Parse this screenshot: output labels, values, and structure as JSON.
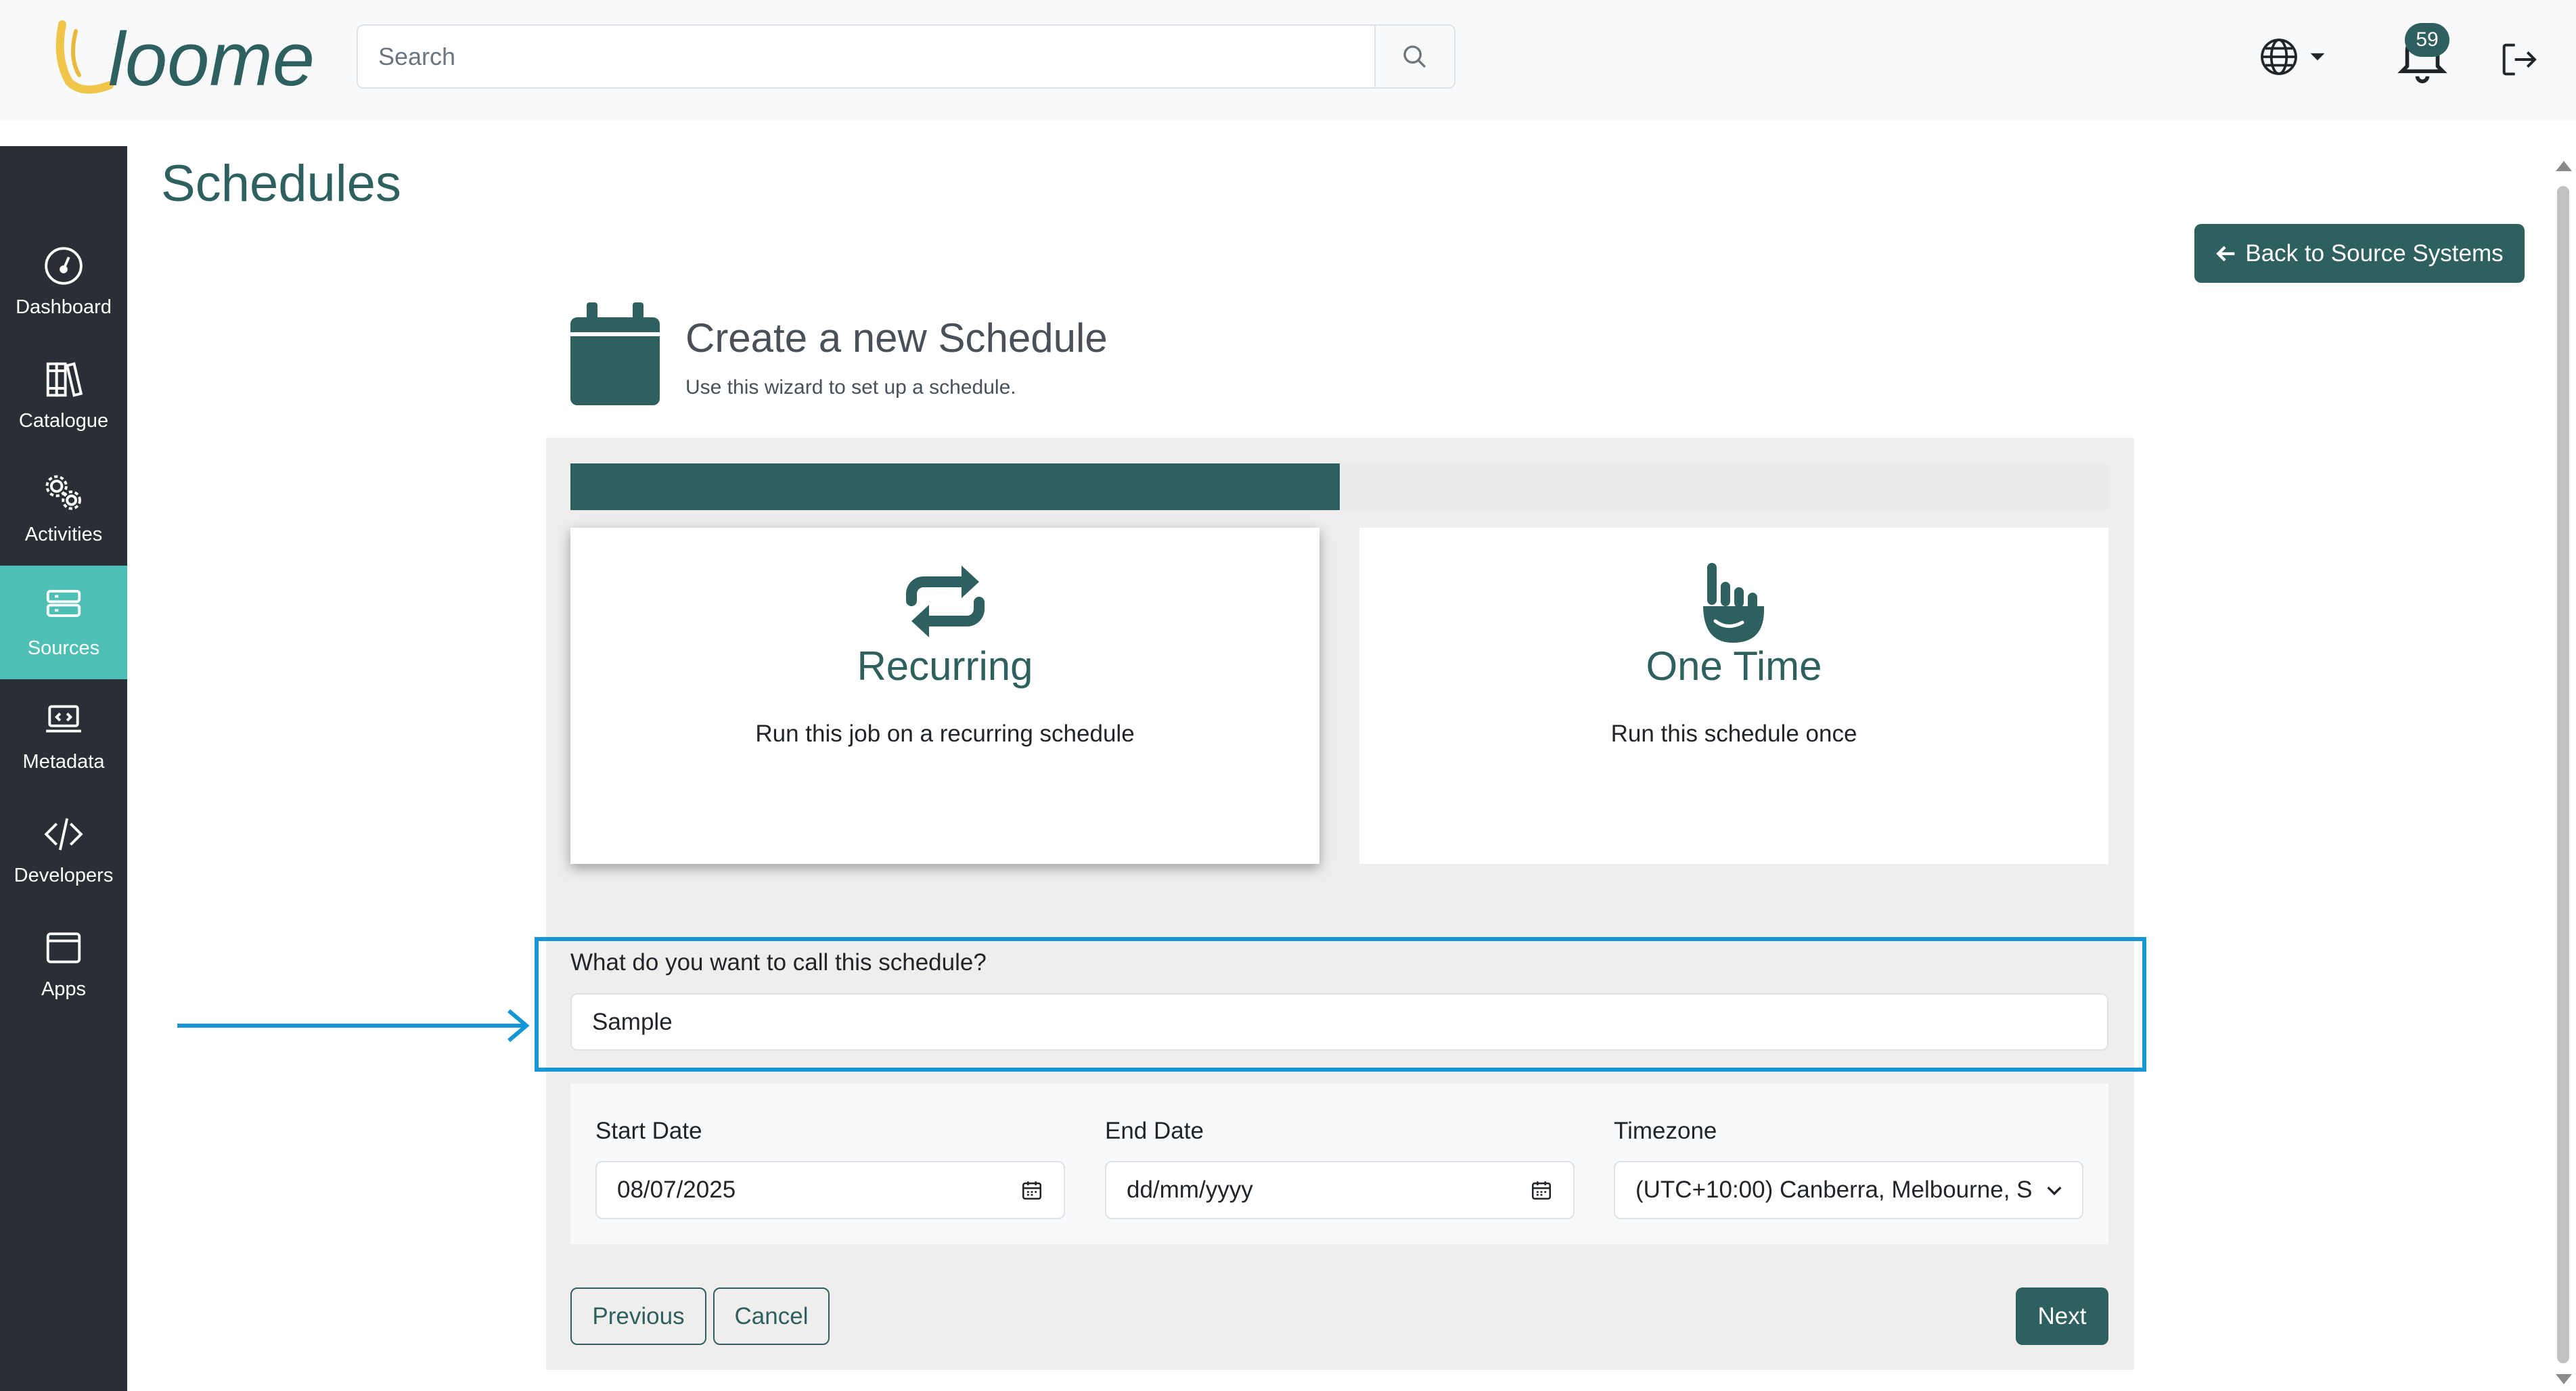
{
  "header": {
    "logo_text": "loome",
    "search": {
      "placeholder": "Search",
      "value": ""
    },
    "notifications_count": "59",
    "icons": [
      "globe-icon",
      "chevron-down-icon",
      "bell-icon",
      "logout-icon",
      "search-icon"
    ]
  },
  "sidebar": {
    "items": [
      {
        "label": "Dashboard",
        "icon": "dashboard-gauge-icon",
        "active": false
      },
      {
        "label": "Catalogue",
        "icon": "books-icon",
        "active": false
      },
      {
        "label": "Activities",
        "icon": "gears-icon",
        "active": false
      },
      {
        "label": "Sources",
        "icon": "server-icon",
        "active": true
      },
      {
        "label": "Metadata",
        "icon": "laptop-code-icon",
        "active": false
      },
      {
        "label": "Developers",
        "icon": "code-icon",
        "active": false
      },
      {
        "label": "Apps",
        "icon": "window-icon",
        "active": false
      }
    ]
  },
  "page": {
    "title": "Schedules",
    "back_button": "Back to Source Systems"
  },
  "wizard": {
    "title": "Create a new Schedule",
    "subtitle": "Use this wizard to set up a schedule.",
    "progress_fraction": 0.5,
    "options": [
      {
        "title": "Recurring",
        "description": "Run this job on a recurring schedule",
        "icon": "repeat-icon",
        "selected": true
      },
      {
        "title": "One Time",
        "description": "Run this schedule once",
        "icon": "hand-pointer-icon",
        "selected": false
      }
    ],
    "name_label": "What do you want to call this schedule?",
    "name_value": "Sample",
    "start_date": {
      "label": "Start Date",
      "value": "08/07/2025"
    },
    "end_date": {
      "label": "End Date",
      "value": "dd/mm/yyyy"
    },
    "timezone": {
      "label": "Timezone",
      "value": "(UTC+10:00) Canberra, Melbourne, S"
    },
    "buttons": {
      "previous": "Previous",
      "cancel": "Cancel",
      "next": "Next"
    }
  },
  "colors": {
    "brand": "#2f6060",
    "sidebar_bg": "#2a2f36",
    "sidebar_active": "#4ebfb4",
    "highlight": "#1597d6"
  }
}
